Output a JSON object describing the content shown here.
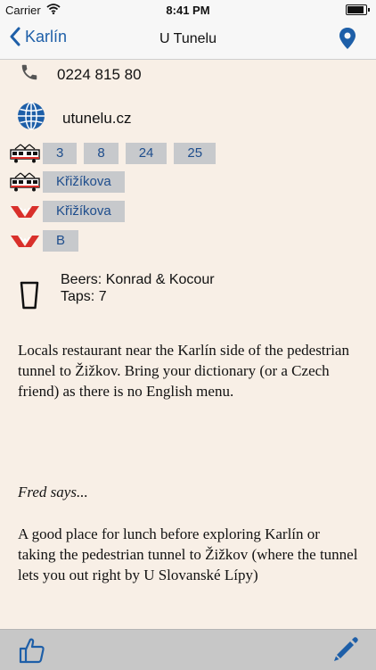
{
  "status": {
    "carrier": "Carrier",
    "time": "8:41 PM"
  },
  "nav": {
    "back_label": "Karlín",
    "title": "U Tunelu"
  },
  "contact": {
    "phone": "0224 815 80",
    "website": "utunelu.cz"
  },
  "transit": {
    "tram_lines": [
      "3",
      "8",
      "24",
      "25"
    ],
    "tram_stop": "Křižíkova",
    "metro_station": "Křižíkova",
    "metro_line": "B"
  },
  "beer": {
    "beers": "Beers: Konrad & Kocour",
    "taps": "Taps: 7"
  },
  "description": "Locals restaurant near the Karlín side of the pedestrian tunnel to Žižkov. Bring your dictionary (or a Czech friend) as there is no English menu.",
  "fred": {
    "label": "Fred says...",
    "text": "A good place for lunch before exploring Karlín or taking the pedestrian tunnel to Žižkov (where the tunnel lets you out right by U Slovanské Lípy)"
  },
  "colors": {
    "accent": "#1e5fa8",
    "background": "#f8efe6",
    "chip": "#c7c9cc",
    "metro_red": "#d9302b"
  },
  "icons": [
    "phone-icon",
    "globe-icon",
    "tram-icon",
    "metro-icon",
    "glass-icon",
    "thumbs-up-icon",
    "pencil-icon",
    "map-pin-icon",
    "wifi-icon",
    "chevron-left-icon"
  ]
}
